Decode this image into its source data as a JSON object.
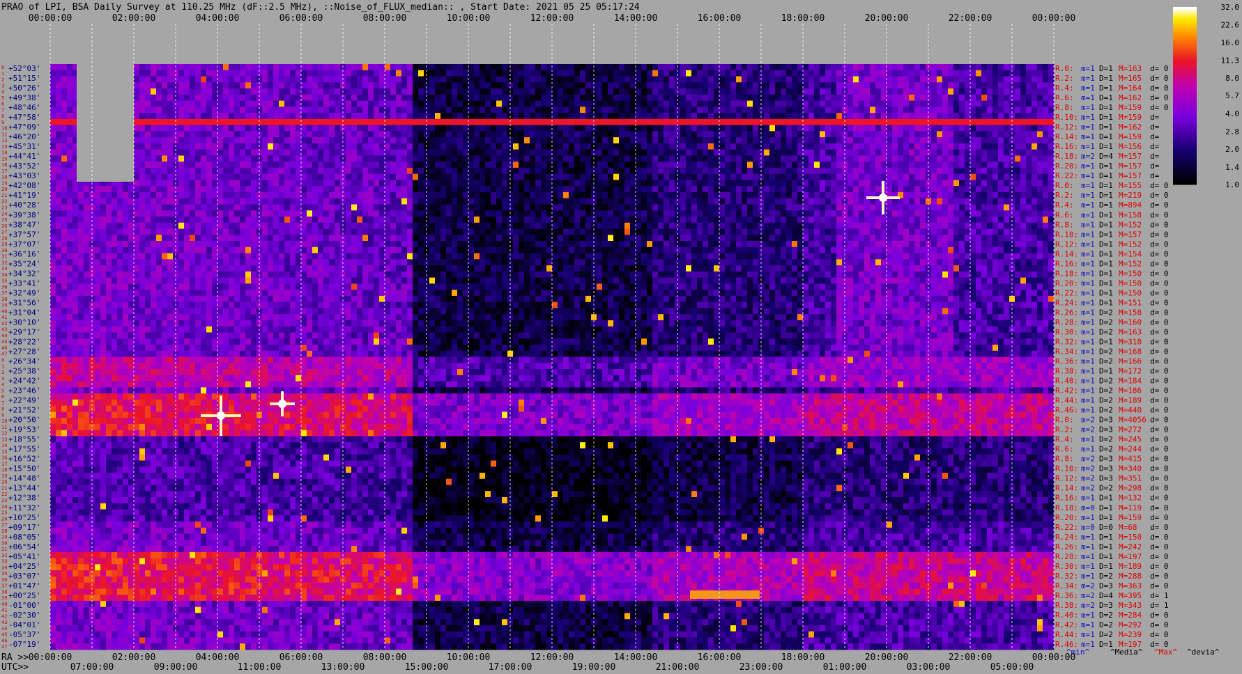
{
  "chart_data": {
    "type": "heatmap",
    "title": "PRAO of LPI, BSA Daily Survey at 110.25 MHz (dF::2.5 MHz), ::Noise_of_FLUX_median:: , Start Date: 2021 05 25 05:17:24",
    "x_top_ticks": [
      "00:00:00",
      "02:00:00",
      "04:00:00",
      "06:00:00",
      "08:00:00",
      "10:00:00",
      "12:00:00",
      "14:00:00",
      "16:00:00",
      "18:00:00",
      "20:00:00",
      "22:00:00",
      "00:00:00"
    ],
    "x_ra_label": "RA >>",
    "x_ra_ticks": [
      "00:00:00",
      "02:00:00",
      "04:00:00",
      "06:00:00",
      "08:00:00",
      "10:00:00",
      "12:00:00",
      "14:00:00",
      "16:00:00",
      "18:00:00",
      "20:00:00",
      "22:00:00",
      "00:00:00"
    ],
    "x_utc_label": "UTC>>",
    "x_utc_ticks": [
      "07:00:00",
      "09:00:00",
      "11:00:00",
      "13:00:00",
      "15:00:00",
      "17:00:00",
      "19:00:00",
      "21:00:00",
      "23:00:00",
      "01:00:00",
      "03:00:00",
      "05:00:00"
    ],
    "y_ticks": [
      "+52°03'",
      "+51°15'",
      "+50°26'",
      "+49°38'",
      "+48°46'",
      "+47°58'",
      "+47°09'",
      "+46°20'",
      "+45°31'",
      "+44°41'",
      "+43°52'",
      "+43°03'",
      "+42°08'",
      "+41°19'",
      "+40°28'",
      "+39°38'",
      "+38°47'",
      "+37°57'",
      "+37°07'",
      "+36°16'",
      "+35°24'",
      "+34°32'",
      "+33°41'",
      "+32°49'",
      "+31°56'",
      "+31°04'",
      "+30°10'",
      "+29°17'",
      "+28°22'",
      "+27°28'",
      "+26°34'",
      "+25°38'",
      "+24°42'",
      "+23°46'",
      "+22°49'",
      "+21°52'",
      "+20°50'",
      "+19°53'",
      "+18°55'",
      "+17°55'",
      "+16°52'",
      "+15°50'",
      "+14°48'",
      "+13°44'",
      "+12°38'",
      "+11°32'",
      "+10°25'",
      "+09°17'",
      "+08°05'",
      "+06°54'",
      "+05°41'",
      "+04°25'",
      "+03°07'",
      "+01°47'",
      "+00°25'",
      "-01°00'",
      "-02°30'",
      "-04°01'",
      "-05°37'",
      "-07°19'"
    ],
    "row_numbers": [
      "0",
      "1",
      "2",
      "3",
      "4",
      "5",
      "6",
      "7",
      "8",
      "9",
      "10",
      "11",
      "12",
      "13",
      "14",
      "15",
      "16",
      "17",
      "18",
      "19",
      "20",
      "21",
      "22",
      "23",
      "24",
      "25",
      "26",
      "27",
      "28",
      "29",
      "30",
      "31",
      "32",
      "33",
      "34",
      "35",
      "36",
      "37",
      "38",
      "39",
      "40",
      "41",
      "42",
      "43",
      "44",
      "45",
      "46",
      "47",
      "0",
      "1",
      "2",
      "3",
      "4",
      "5",
      "6",
      "7",
      "8",
      "9",
      "10",
      "11",
      "12",
      "13",
      "14",
      "15",
      "16",
      "17",
      "18",
      "19",
      "20",
      "21",
      "22",
      "23",
      "24",
      "25",
      "26",
      "27",
      "28",
      "29",
      "30",
      "31",
      "32",
      "33",
      "34",
      "35",
      "36",
      "37",
      "38",
      "39",
      "40",
      "41",
      "42",
      "43",
      "44",
      "45",
      "46",
      "47"
    ],
    "colorbar": {
      "ticks": [
        "32.0",
        "22.6",
        "16.0",
        "11.3",
        "8.0",
        "5.7",
        "4.0",
        "2.8",
        "2.0",
        "1.4",
        "1.0"
      ],
      "min": 1.0,
      "max": 32.0,
      "scale": "log"
    },
    "row_stats": [
      {
        "r": "R.0:",
        "m": "m=1",
        "D": "D=1",
        "M": "M=163",
        "d": "d= 0"
      },
      {
        "r": "R.2:",
        "m": "m=1",
        "D": "D=1",
        "M": "M=165",
        "d": "d= 0"
      },
      {
        "r": "R.4:",
        "m": "m=1",
        "D": "D=1",
        "M": "M=164",
        "d": "d= 0"
      },
      {
        "r": "R.6:",
        "m": "m=1",
        "D": "D=1",
        "M": "M=162",
        "d": "d= 0"
      },
      {
        "r": "R.8:",
        "m": "m=1",
        "D": "D=1",
        "M": "M=159",
        "d": "d= 0"
      },
      {
        "r": "R.10:",
        "m": "m=1",
        "D": "D=1",
        "M": "M=159",
        "d": "d="
      },
      {
        "r": "R.12:",
        "m": "m=1",
        "D": "D=1",
        "M": "M=162",
        "d": "d="
      },
      {
        "r": "R.14:",
        "m": "m=1",
        "D": "D=1",
        "M": "M=159",
        "d": "d="
      },
      {
        "r": "R.16:",
        "m": "m=1",
        "D": "D=1",
        "M": "M=156",
        "d": "d="
      },
      {
        "r": "R.18:",
        "m": "m=2",
        "D": "D=4",
        "M": "M=157",
        "d": "d="
      },
      {
        "r": "R.20:",
        "m": "m=1",
        "D": "D=1",
        "M": "M=157",
        "d": "d="
      },
      {
        "r": "R.22:",
        "m": "m=1",
        "D": "D=1",
        "M": "M=157",
        "d": "d="
      },
      {
        "r": "R.0:",
        "m": "m=1",
        "D": "D=1",
        "M": "M=155",
        "d": "d= 0"
      },
      {
        "r": "R.2:",
        "m": "m=1",
        "D": "D=1",
        "M": "M=219",
        "d": "d= 0"
      },
      {
        "r": "R.4:",
        "m": "m=1",
        "D": "D=1",
        "M": "M=894",
        "d": "d= 0"
      },
      {
        "r": "R.6:",
        "m": "m=1",
        "D": "D=1",
        "M": "M=158",
        "d": "d= 0"
      },
      {
        "r": "R.8:",
        "m": "m=1",
        "D": "D=1",
        "M": "M=152",
        "d": "d= 0"
      },
      {
        "r": "R.10:",
        "m": "m=1",
        "D": "D=1",
        "M": "M=157",
        "d": "d= 0"
      },
      {
        "r": "R.12:",
        "m": "m=1",
        "D": "D=1",
        "M": "M=152",
        "d": "d= 0"
      },
      {
        "r": "R.14:",
        "m": "m=1",
        "D": "D=1",
        "M": "M=154",
        "d": "d= 0"
      },
      {
        "r": "R.16:",
        "m": "m=1",
        "D": "D=1",
        "M": "M=152",
        "d": "d= 0"
      },
      {
        "r": "R.18:",
        "m": "m=1",
        "D": "D=1",
        "M": "M=150",
        "d": "d= 0"
      },
      {
        "r": "R.20:",
        "m": "m=1",
        "D": "D=1",
        "M": "M=150",
        "d": "d= 0"
      },
      {
        "r": "R.22:",
        "m": "m=1",
        "D": "D=1",
        "M": "M=150",
        "d": "d= 0"
      },
      {
        "r": "R.24:",
        "m": "m=1",
        "D": "D=1",
        "M": "M=151",
        "d": "d= 0"
      },
      {
        "r": "R.26:",
        "m": "m=1",
        "D": "D=2",
        "M": "M=158",
        "d": "d= 0"
      },
      {
        "r": "R.28:",
        "m": "m=1",
        "D": "D=2",
        "M": "M=160",
        "d": "d= 0"
      },
      {
        "r": "R.30:",
        "m": "m=1",
        "D": "D=2",
        "M": "M=163",
        "d": "d= 0"
      },
      {
        "r": "R.32:",
        "m": "m=1",
        "D": "D=1",
        "M": "M=310",
        "d": "d= 0"
      },
      {
        "r": "R.34:",
        "m": "m=1",
        "D": "D=2",
        "M": "M=168",
        "d": "d= 0"
      },
      {
        "r": "R.36:",
        "m": "m=1",
        "D": "D=2",
        "M": "M=166",
        "d": "d= 0"
      },
      {
        "r": "R.38:",
        "m": "m=1",
        "D": "D=1",
        "M": "M=172",
        "d": "d= 0"
      },
      {
        "r": "R.40:",
        "m": "m=1",
        "D": "D=2",
        "M": "M=184",
        "d": "d= 0"
      },
      {
        "r": "R.42:",
        "m": "m=1",
        "D": "D=2",
        "M": "M=186",
        "d": "d= 0"
      },
      {
        "r": "R.44:",
        "m": "m=1",
        "D": "D=2",
        "M": "M=189",
        "d": "d= 0"
      },
      {
        "r": "R.46:",
        "m": "m=1",
        "D": "D=2",
        "M": "M=440",
        "d": "d= 0"
      },
      {
        "r": "R.0:",
        "m": "m=2",
        "D": "D=3",
        "M": "M=4056",
        "d": "d= 0"
      },
      {
        "r": "R.2:",
        "m": "m=2",
        "D": "D=3",
        "M": "M=272",
        "d": "d= 0"
      },
      {
        "r": "R.4:",
        "m": "m=1",
        "D": "D=2",
        "M": "M=245",
        "d": "d= 0"
      },
      {
        "r": "R.6:",
        "m": "m=1",
        "D": "D=2",
        "M": "M=244",
        "d": "d= 0"
      },
      {
        "r": "R.8:",
        "m": "m=2",
        "D": "D=3",
        "M": "M=415",
        "d": "d= 0"
      },
      {
        "r": "R.10:",
        "m": "m=2",
        "D": "D=3",
        "M": "M=340",
        "d": "d= 0"
      },
      {
        "r": "R.12:",
        "m": "m=2",
        "D": "D=3",
        "M": "M=351",
        "d": "d= 0"
      },
      {
        "r": "R.14:",
        "m": "m=2",
        "D": "D=2",
        "M": "M=298",
        "d": "d= 0"
      },
      {
        "r": "R.16:",
        "m": "m=1",
        "D": "D=1",
        "M": "M=132",
        "d": "d= 0"
      },
      {
        "r": "R.18:",
        "m": "m=0",
        "D": "D=1",
        "M": "M=119",
        "d": "d= 0"
      },
      {
        "r": "R.20:",
        "m": "m=1",
        "D": "D=1",
        "M": "M=159",
        "d": "d= 0"
      },
      {
        "r": "R.22:",
        "m": "m=0",
        "D": "D=0",
        "M": "M=68",
        "d": "d= 0"
      },
      {
        "r": "R.24:",
        "m": "m=1",
        "D": "D=1",
        "M": "M=150",
        "d": "d= 0"
      },
      {
        "r": "R.26:",
        "m": "m=1",
        "D": "D=1",
        "M": "M=242",
        "d": "d= 0"
      },
      {
        "r": "R.28:",
        "m": "m=1",
        "D": "D=1",
        "M": "M=197",
        "d": "d= 0"
      },
      {
        "r": "R.30:",
        "m": "m=1",
        "D": "D=1",
        "M": "M=189",
        "d": "d= 0"
      },
      {
        "r": "R.32:",
        "m": "m=1",
        "D": "D=2",
        "M": "M=288",
        "d": "d= 0"
      },
      {
        "r": "R.34:",
        "m": "m=2",
        "D": "D=3",
        "M": "M=363",
        "d": "d= 0"
      },
      {
        "r": "R.36:",
        "m": "m=2",
        "D": "D=4",
        "M": "M=395",
        "d": "d= 1"
      },
      {
        "r": "R.38:",
        "m": "m=2",
        "D": "D=3",
        "M": "M=343",
        "d": "d= 1"
      },
      {
        "r": "R.40:",
        "m": "m=1",
        "D": "D=2",
        "M": "M=284",
        "d": "d= 0"
      },
      {
        "r": "R.42:",
        "m": "m=1",
        "D": "D=2",
        "M": "M=292",
        "d": "d= 0"
      },
      {
        "r": "R.44:",
        "m": "m=1",
        "D": "D=2",
        "M": "M=239",
        "d": "d= 0"
      },
      {
        "r": "R.46:",
        "m": "m=1",
        "D": "D=1",
        "M": "M=197",
        "d": "d= 0"
      }
    ],
    "stats_legend": [
      "^min^",
      "^Media^",
      "^Max^",
      "^devia^"
    ],
    "colors": {
      "background": "#a6a6a6",
      "stat_red": "#e00000",
      "stat_blue": "#1010c0",
      "grid": "#ffffff",
      "ytick_red": "#cc0000",
      "ytick_text": "#000080"
    }
  }
}
